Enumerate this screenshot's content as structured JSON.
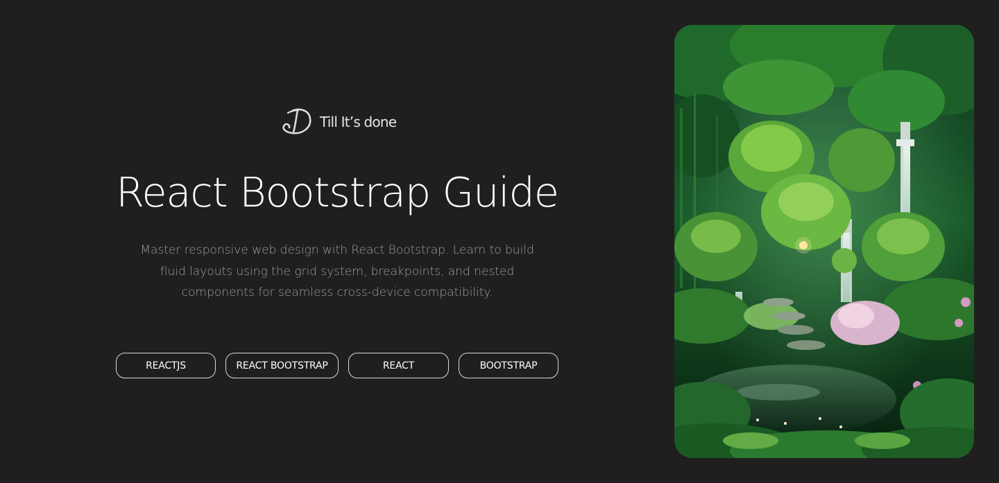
{
  "brand": {
    "logo_icon": "brand-logo-icon",
    "name": "Till It’s done"
  },
  "hero": {
    "title": "React Bootstrap Guide",
    "description": "Master responsive web design with React Bootstrap. Learn to build fluid layouts using the grid system, breakpoints, and nested components for seamless cross-device compatibility."
  },
  "tags": [
    {
      "label": "REACTJS"
    },
    {
      "label": "REACT BOOTSTRAP"
    },
    {
      "label": "REACT"
    },
    {
      "label": "BOOTSTRAP"
    }
  ],
  "image": {
    "subject": "fantasy-garden-illustration"
  },
  "colors": {
    "background": "#1f1f1f",
    "title": "#ffffff",
    "description": "#9d9d9d",
    "tag_border": "#d9d9d9"
  }
}
